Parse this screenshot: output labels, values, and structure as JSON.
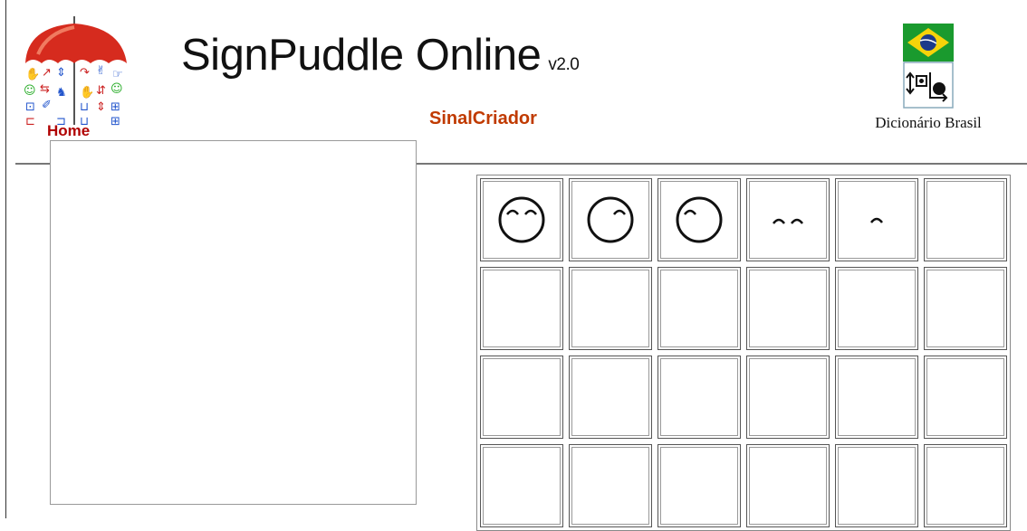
{
  "header": {
    "title": "SignPuddle Online",
    "version": "v2.0",
    "subtitle": "SinalCriador",
    "home_label": "Home",
    "dictionary_label": "Dicionário Brasil"
  },
  "colors": {
    "home": "#b00000",
    "subtitle": "#c03a00",
    "umbrella": "#d62b1e"
  },
  "icons": {
    "logo": "umbrella-logo-icon",
    "flag": "brazil-flag-icon",
    "dictionary": "signwriting-dictionary-icon"
  },
  "palette": {
    "rows": 4,
    "columns": 6,
    "symbols": [
      "face-both-eyes-closed-symbol",
      "face-right-eye-closed-symbol",
      "face-left-eye-closed-symbol",
      "both-eyes-closed-symbol",
      "single-eye-closed-symbol",
      "",
      "",
      "",
      "",
      "",
      "",
      "",
      "",
      "",
      "",
      "",
      "",
      "",
      "",
      "",
      "",
      "",
      "",
      ""
    ]
  }
}
